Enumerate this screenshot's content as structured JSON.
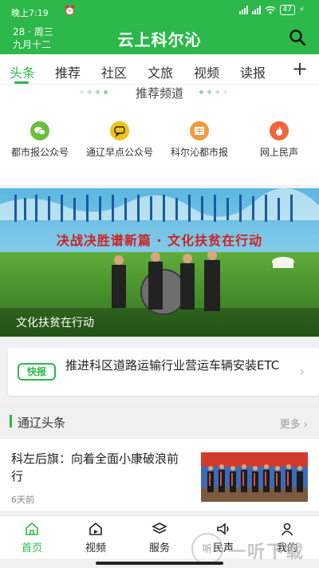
{
  "status_bar": {
    "time": "晚上7:19",
    "battery": "47"
  },
  "header": {
    "date_line1": "28 · 周三",
    "date_line2": "九月十二",
    "app_title": "云上科尔沁"
  },
  "tabs": [
    "头条",
    "推荐",
    "社区",
    "文旅",
    "视频",
    "读报"
  ],
  "channels": {
    "title": "推荐频道",
    "items": [
      {
        "label": "都市报公众号",
        "icon": "wechat-icon",
        "color": "#6cbf3c"
      },
      {
        "label": "通辽早点公众号",
        "icon": "chat-bubble-icon",
        "color": "#f2c21a"
      },
      {
        "label": "科尔沁都市报",
        "icon": "newspaper-icon",
        "color": "#f29a3c"
      },
      {
        "label": "网上民声",
        "icon": "flame-icon",
        "color": "#f0653a"
      }
    ]
  },
  "banner": {
    "headline": "决战决胜谱新篇 · 文化扶贫在行动",
    "caption": "文化扶贫在行动"
  },
  "flash": {
    "badge": "快报",
    "text": "推进科区道路运输行业营运车辆安装ETC"
  },
  "section": {
    "title": "通辽头条",
    "more": "更多 ›"
  },
  "news": [
    {
      "title": "科左后旗：向着全面小康破浪前行",
      "time": "6天前"
    }
  ],
  "bottom_nav": [
    {
      "label": "首页",
      "icon": "home-icon",
      "active": true
    },
    {
      "label": "视频",
      "icon": "video-home-icon",
      "active": false
    },
    {
      "label": "服务",
      "icon": "layers-icon",
      "active": false
    },
    {
      "label": "民声",
      "icon": "speaker-icon",
      "active": false
    },
    {
      "label": "我的",
      "icon": "user-icon",
      "active": false
    }
  ],
  "watermark": {
    "badge": "听",
    "text": "一听下载"
  },
  "colors": {
    "brand": "#2cb84a"
  }
}
